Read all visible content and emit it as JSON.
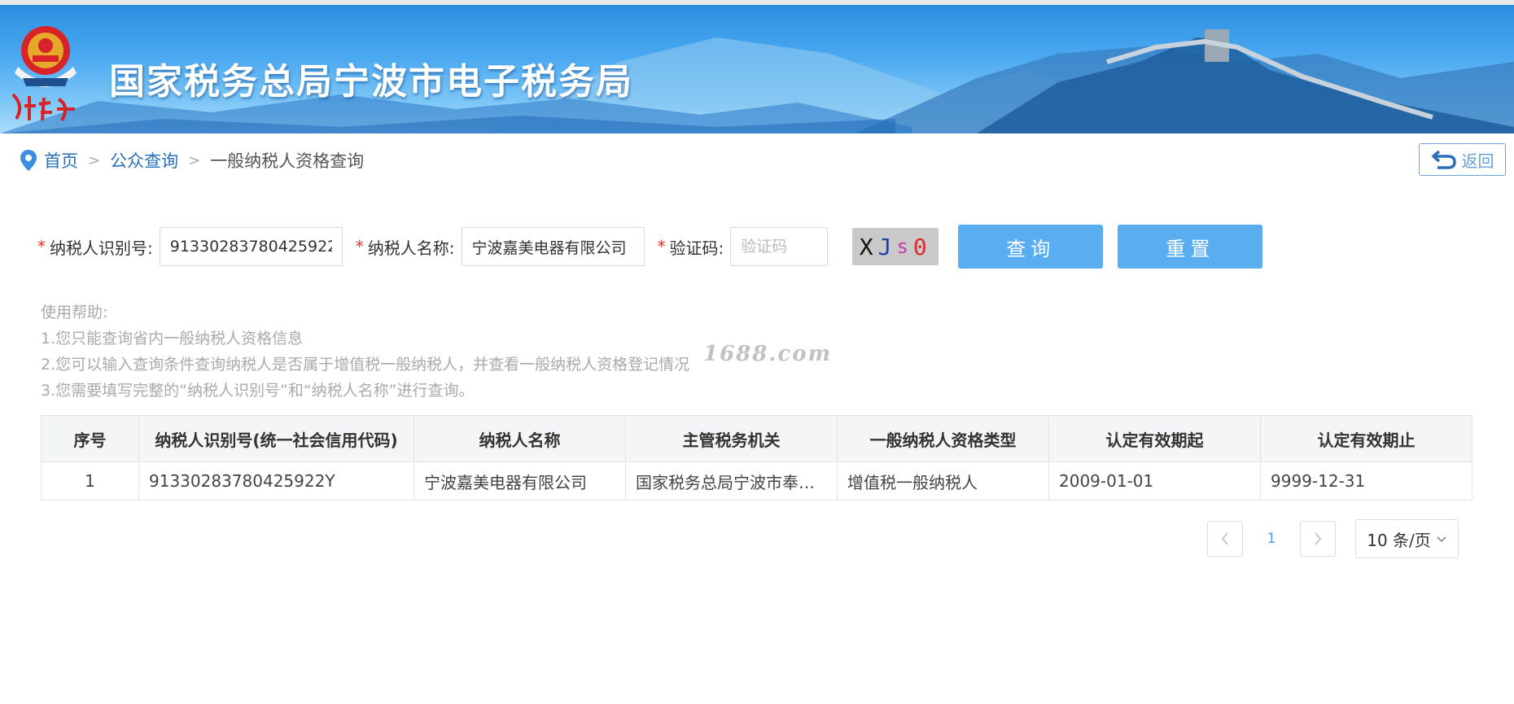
{
  "header": {
    "site_title": "国家税务总局宁波市电子税务局",
    "emblem_caption": "中国税务"
  },
  "breadcrumb": {
    "home": "首页",
    "separator": ">",
    "public_query": "公众查询",
    "current": "一般纳税人资格查询"
  },
  "back_button": {
    "label": "返回"
  },
  "form": {
    "taxpayer_id_label": "纳税人识别号:",
    "taxpayer_id_value": "91330283780425922Y",
    "taxpayer_name_label": "纳税人名称:",
    "taxpayer_name_value": "宁波嘉美电器有限公司",
    "captcha_label": "验证码:",
    "captcha_placeholder": "验证码",
    "captcha_chars": [
      "X",
      "J",
      "s",
      "0"
    ],
    "required_mark": "*",
    "query_button": "查询",
    "reset_button": "重置"
  },
  "help": {
    "title": "使用帮助:",
    "lines": [
      "1.您只能查询省内一般纳税人资格信息",
      "2.您可以输入查询条件查询纳税人是否属于增值税一般纳税人，并查看一般纳税人资格登记情况",
      "3.您需要填写完整的“纳税人识别号”和“纳税人名称”进行查询。"
    ]
  },
  "watermark": "1688.com",
  "table": {
    "headers": [
      "序号",
      "纳税人识别号(统一社会信用代码)",
      "纳税人名称",
      "主管税务机关",
      "一般纳税人资格类型",
      "认定有效期起",
      "认定有效期止"
    ],
    "rows": [
      [
        "1",
        "91330283780425922Y",
        "宁波嘉美电器有限公司",
        "国家税务总局宁波市奉…",
        "增值税一般纳税人",
        "2009-01-01",
        "9999-12-31"
      ]
    ]
  },
  "pagination": {
    "current_page": "1",
    "page_size": "10 条/页"
  },
  "colors": {
    "primary_button": "#5aaef0",
    "link": "#2a6fb8",
    "required": "#e0322f",
    "captcha_colors": [
      "#111111",
      "#1b3fa8",
      "#c23fb0",
      "#e02a2a"
    ]
  }
}
